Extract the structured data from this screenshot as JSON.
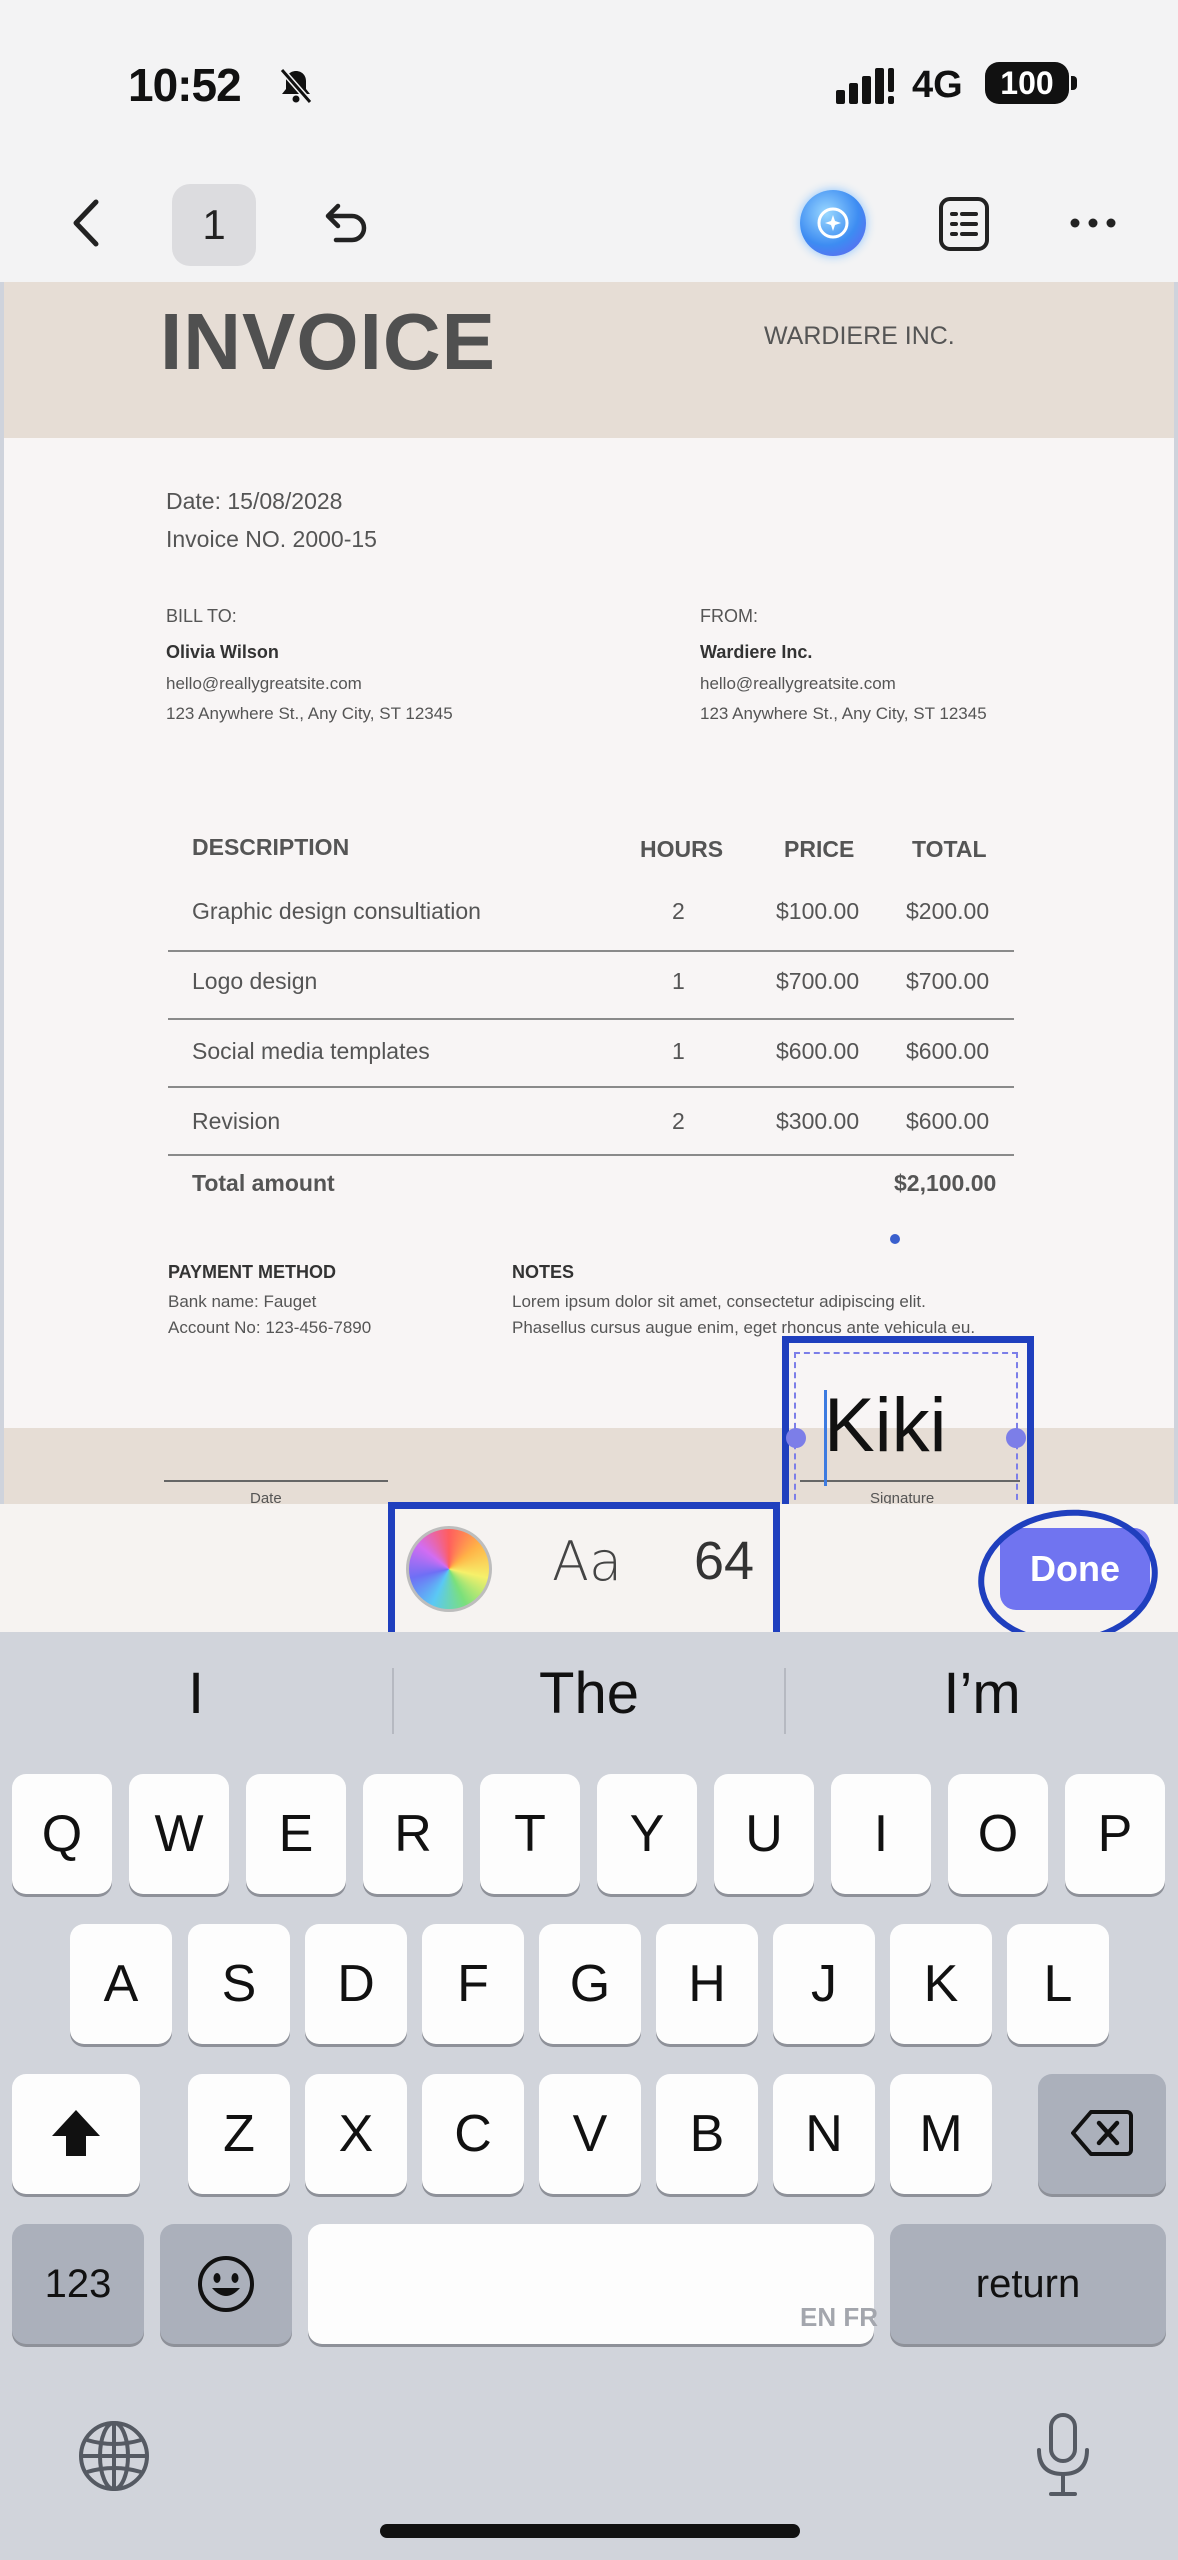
{
  "status_bar": {
    "time": "10:52",
    "network": "4G",
    "battery": "100"
  },
  "toolbar": {
    "page_number": "1"
  },
  "invoice": {
    "title": "INVOICE",
    "company": "WARDIERE INC.",
    "date": "Date: 15/08/2028",
    "number": "Invoice NO. 2000-15",
    "bill_to": {
      "label": "BILL TO:",
      "name": "Olivia Wilson",
      "email": "hello@reallygreatsite.com",
      "address": "123 Anywhere St., Any City, ST 12345"
    },
    "from": {
      "label": "FROM:",
      "name": "Wardiere Inc.",
      "email": "hello@reallygreatsite.com",
      "address": "123 Anywhere St., Any City, ST 12345"
    },
    "table": {
      "headers": [
        "DESCRIPTION",
        "HOURS",
        "PRICE",
        "TOTAL"
      ],
      "rows": [
        [
          "Graphic design consultiation",
          "2",
          "$100.00",
          "$200.00"
        ],
        [
          "Logo design",
          "1",
          "$700.00",
          "$700.00"
        ],
        [
          "Social media templates",
          "1",
          "$600.00",
          "$600.00"
        ],
        [
          "Revision",
          "2",
          "$300.00",
          "$600.00"
        ]
      ],
      "total_label": "Total amount",
      "total_value": "$2,100.00"
    },
    "payment": {
      "label": "PAYMENT METHOD",
      "bank": "Bank name: Fauget",
      "account": "Account No: 123-456-7890"
    },
    "notes": {
      "label": "NOTES",
      "line1": "Lorem ipsum dolor sit amet, consectetur adipiscing elit.",
      "line2": "Phasellus cursus augue enim, eget rhoncus ante vehicula eu."
    },
    "date_label": "Date",
    "signature_label": "Signature"
  },
  "text_box": {
    "value": "Kiki"
  },
  "format_bar": {
    "font_label": "Aa",
    "font_size": "64",
    "done_label": "Done"
  },
  "keyboard": {
    "suggestions": [
      "I",
      "The",
      "I’m"
    ],
    "row1": [
      "Q",
      "W",
      "E",
      "R",
      "T",
      "Y",
      "U",
      "I",
      "O",
      "P"
    ],
    "row2": [
      "A",
      "S",
      "D",
      "F",
      "G",
      "H",
      "J",
      "K",
      "L"
    ],
    "row3": [
      "Z",
      "X",
      "C",
      "V",
      "B",
      "N",
      "M"
    ],
    "numbers_label": "123",
    "return_label": "return",
    "space_languages": "EN FR"
  }
}
